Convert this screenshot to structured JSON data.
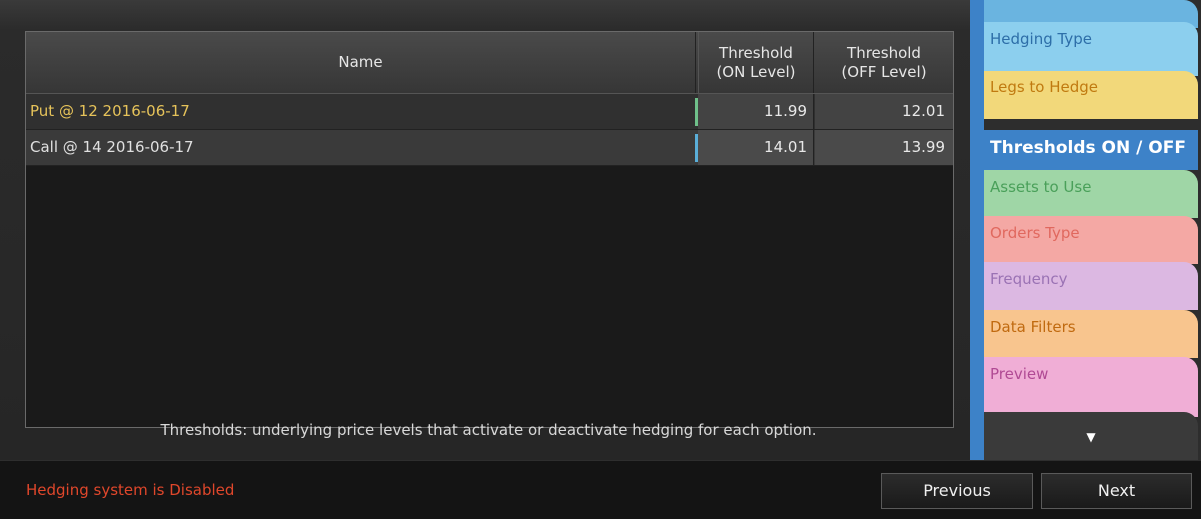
{
  "table": {
    "headers": {
      "name": "Name",
      "on_line1": "Threshold",
      "on_line2": "(ON Level)",
      "off_line1": "Threshold",
      "off_line2": "(OFF Level)"
    },
    "rows": [
      {
        "name": "Put @ 12 2016-06-17",
        "on": "11.99",
        "off": "12.01"
      },
      {
        "name": "Call @ 14 2016-06-17",
        "on": "14.01",
        "off": "13.99"
      }
    ]
  },
  "caption": "Thresholds: underlying price levels that activate or deactivate hedging for each option.",
  "status": "Hedging system is Disabled",
  "buttons": {
    "previous": "Previous",
    "next": "Next"
  },
  "tabs": {
    "hedging_type": "Hedging Type",
    "legs_to_hedge": "Legs to Hedge",
    "thresholds": "Thresholds ON / OFF",
    "assets_to_use": "Assets to Use",
    "orders_type": "Orders Type",
    "frequency": "Frequency",
    "data_filters": "Data Filters",
    "preview": "Preview",
    "more_icon": "chevron-down-icon"
  },
  "colors": {
    "accent": "#3d82c8",
    "status_error": "#e0472b",
    "put_name": "#e6c35a"
  }
}
